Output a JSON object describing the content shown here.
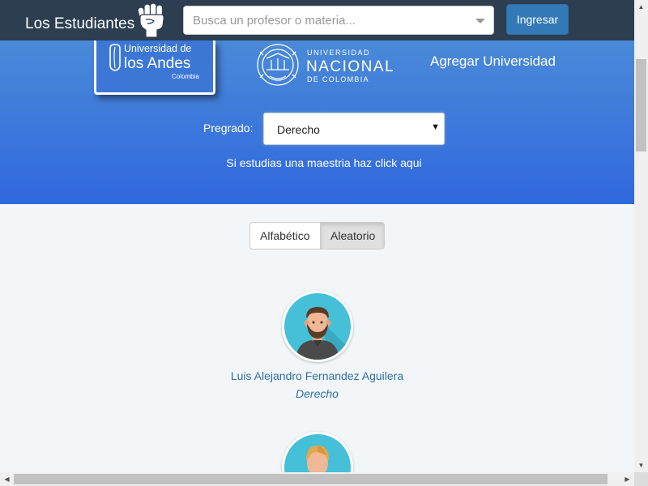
{
  "navbar": {
    "brand": "Los Estudiantes",
    "search_placeholder": "Busca un profesor o materia...",
    "login_label": "Ingresar"
  },
  "hero": {
    "uniandes_logo": {
      "line1": "Universidad de",
      "line2": "los Andes",
      "line3": "Colombia"
    },
    "unal_logo": {
      "line1": "UNIVERSIDAD",
      "line2": "NACIONAL",
      "line3": "DE COLOMBIA"
    },
    "add_university": "Agregar Universidad",
    "pregrado_label": "Pregrado:",
    "pregrado_value": "Derecho",
    "maestria_text": "Si estudias una maestria haz click aqui"
  },
  "sort": {
    "alphabetic": "Alfabético",
    "random": "Aleatorio",
    "active": "random"
  },
  "professors": [
    {
      "name": "Luis Alejandro Fernandez Aguilera",
      "program": "Derecho",
      "avatar": "bearded-man-avatar"
    },
    {
      "name": "",
      "program": "",
      "avatar": "blond-man-avatar"
    }
  ],
  "colors": {
    "navbar": "#2c3e50",
    "hero_top": "#4a8ad8",
    "hero_bottom": "#3068de",
    "link": "#2f6fa7",
    "login_button": "#337ab7",
    "avatar_bg": "#45c0d8"
  }
}
